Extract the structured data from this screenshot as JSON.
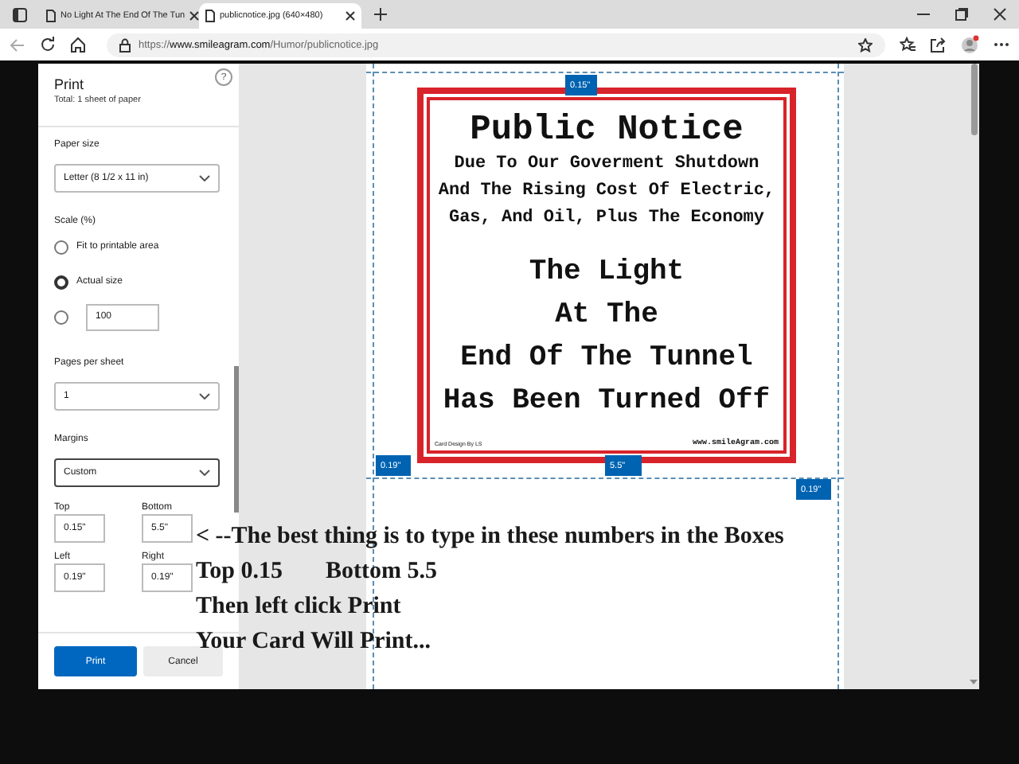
{
  "browser": {
    "tabs": [
      {
        "title": "No Light At The End Of The Tun",
        "selected": false
      },
      {
        "title": "publicnotice.jpg (640×480)",
        "selected": true
      }
    ],
    "url": {
      "scheme": "https://",
      "host": "www.smileagram.com",
      "path": "/Humor/publicnotice.jpg"
    }
  },
  "print_panel": {
    "title": "Print",
    "summary": "Total: 1 sheet of paper",
    "help": "?",
    "paper_size": {
      "label": "Paper size",
      "value": "Letter (8 1/2 x 11 in)"
    },
    "scale": {
      "label": "Scale (%)",
      "options": [
        {
          "kind": "label",
          "label": "Fit to printable area",
          "selected": false
        },
        {
          "kind": "label",
          "label": "Actual size",
          "selected": true
        },
        {
          "kind": "field",
          "value": "100",
          "selected": false
        }
      ]
    },
    "pages_per_sheet": {
      "label": "Pages per sheet",
      "value": "1"
    },
    "margins": {
      "label": "Margins",
      "value": "Custom",
      "focused": true,
      "fields": [
        {
          "label": "Top",
          "value": "0.15\""
        },
        {
          "label": "Bottom",
          "value": "5.5\""
        },
        {
          "label": "Left",
          "value": "0.19\""
        },
        {
          "label": "Right",
          "value": "0.19\""
        }
      ]
    },
    "buttons": [
      {
        "label": "Print",
        "kind": "primary"
      },
      {
        "label": "Cancel",
        "kind": "secondary"
      }
    ]
  },
  "preview": {
    "margin_labels": {
      "top": "0.15\"",
      "left": "0.19\"",
      "bottom": "5.5\"",
      "right": "0.19\""
    },
    "notice": {
      "title": "Public Notice",
      "subtitle_lines": [
        "Due To Our Goverment Shutdown",
        "And The Rising Cost Of Electric,",
        "Gas, And Oil, Plus The Economy"
      ],
      "message_lines": [
        "The Light",
        "At The",
        "End Of The Tunnel",
        "Has Been Turned Off"
      ],
      "credit": "Card Design By LS",
      "website": "www.smileAgram.com"
    }
  },
  "note": {
    "lines": [
      [
        "< --The best thing is to type in these numbers in the Boxes"
      ],
      [
        "Top 0.15",
        "Bottom 5.5"
      ],
      [
        "Then left click Print"
      ],
      [
        "Your Card Will Print..."
      ]
    ]
  }
}
